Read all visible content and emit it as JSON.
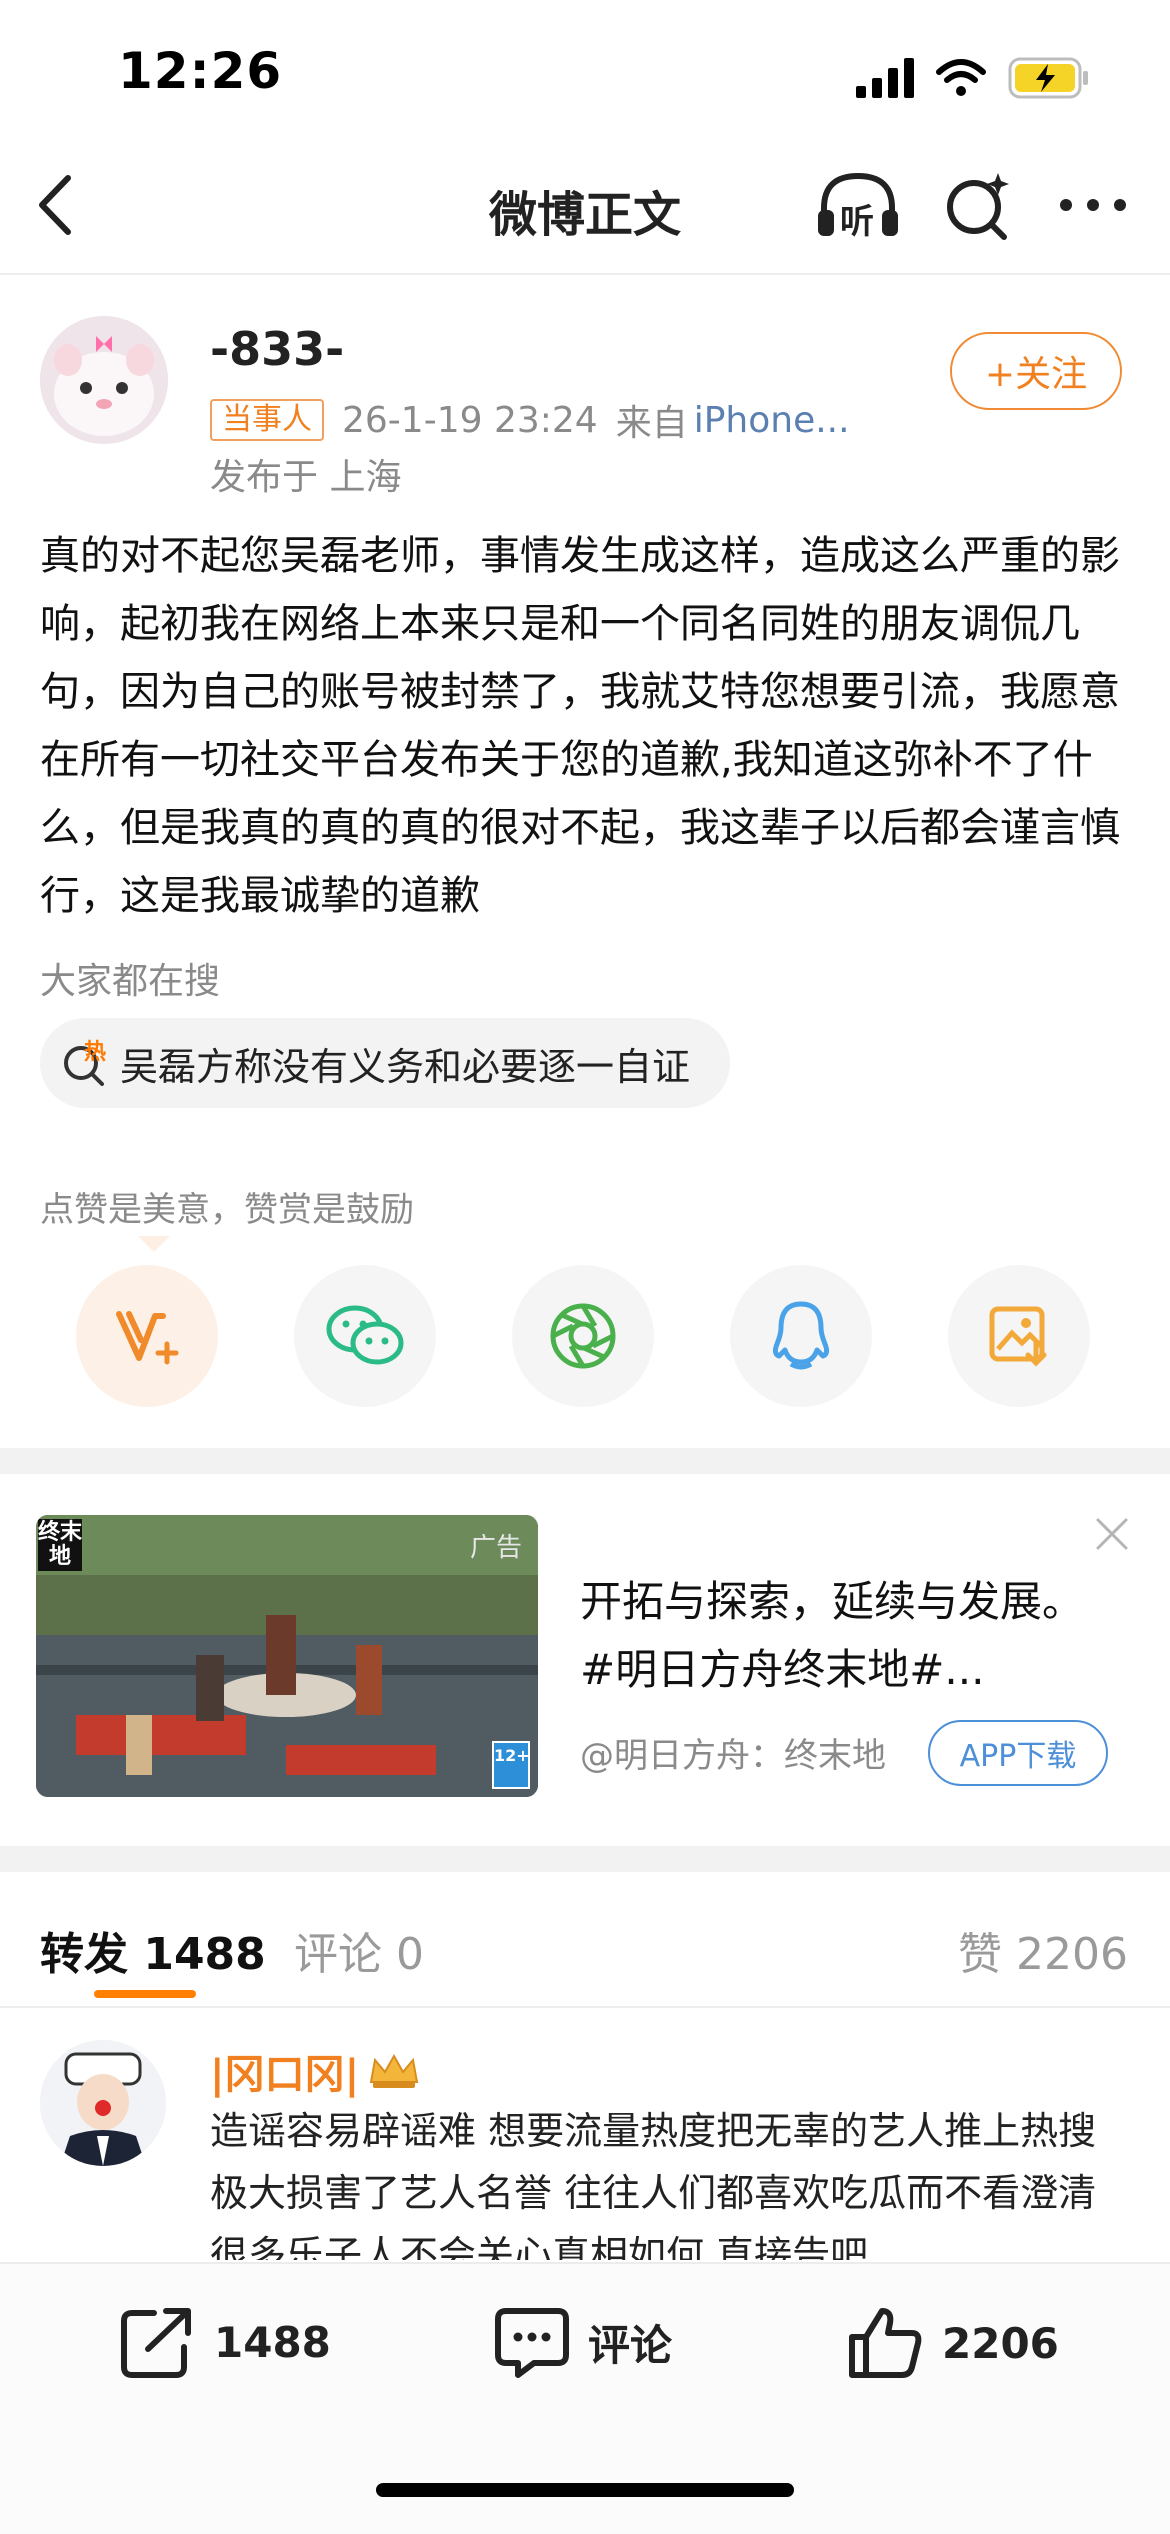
{
  "status": {
    "time": "12:26"
  },
  "nav": {
    "title": "微博正文",
    "listen_label": "听"
  },
  "author": {
    "name": "-833-",
    "badge": "当事人",
    "datetime": "26-1-19 23:24",
    "source_prefix": "来自",
    "source": "iPhone...",
    "location": "发布于 上海",
    "follow_label": "+关注"
  },
  "post": {
    "text": "真的对不起您吴磊老师，事情发生成这样，造成这么严重的影响，起初我在网络上本来只是和一个同名同姓的朋友调侃几句，因为自己的账号被封禁了，我就艾特您想要引流，我愿意在所有一切社交平台发布关于您的道歉,我知道这弥补不了什么，但是我真的真的真的很对不起，我这辈子以后都会谨言慎行，这是我最诚挚的道歉"
  },
  "search": {
    "heading": "大家都在搜",
    "hot_mark": "热",
    "query": "吴磊方称没有义务和必要逐一自证"
  },
  "support": {
    "text": "点赞是美意，赞赏是鼓励",
    "share_icons": [
      "reward-v-plus-icon",
      "wechat-icon",
      "moments-icon",
      "qq-icon",
      "save-image-icon"
    ],
    "colors": {
      "reward": "#f08a2a",
      "wechat": "#2bbb86",
      "moments": "#49b04b",
      "qq": "#4aa3e8",
      "save": "#f3a83a"
    }
  },
  "ad": {
    "badge": "广告",
    "logo_text": "终末地",
    "rating": "12+",
    "title": "开拓与探索，延续与发展。#明日方舟终末地#...",
    "source": "@明日方舟：终末地",
    "button": "APP下载"
  },
  "tabs": {
    "repost_label": "转发",
    "repost_count": "1488",
    "comment_label": "评论",
    "comment_count": "0",
    "like_label": "赞",
    "like_count": "2206"
  },
  "repost_item": {
    "name": "|冈口冈|",
    "text": "造谣容易辟谣难 想要流量热度把无辜的艺人推上热搜 极大损害了艺人名誉 往往人们都喜欢吃瓜而不看澄清 很多乐子人不会关心真相如何 直接告吧"
  },
  "bottom_bar": {
    "repost_count": "1488",
    "comment_label": "评论",
    "like_count": "2206"
  }
}
